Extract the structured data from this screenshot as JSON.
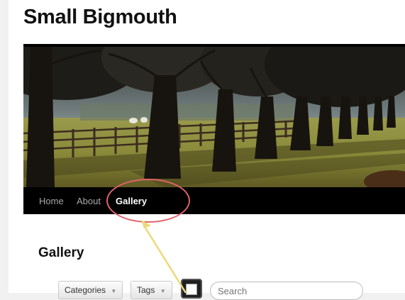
{
  "site": {
    "title": "Small Bigmouth"
  },
  "nav": {
    "items": [
      {
        "label": "Home"
      },
      {
        "label": "About"
      },
      {
        "label": "Gallery",
        "active": true
      }
    ]
  },
  "content": {
    "heading": "Gallery"
  },
  "filters": {
    "categories_label": "Categories",
    "tags_label": "Tags",
    "search_placeholder": "Search"
  },
  "colors": {
    "nav_background": "#000000",
    "annotation_ellipse": "#e0636b",
    "annotation_arrow": "#ecd97a"
  }
}
